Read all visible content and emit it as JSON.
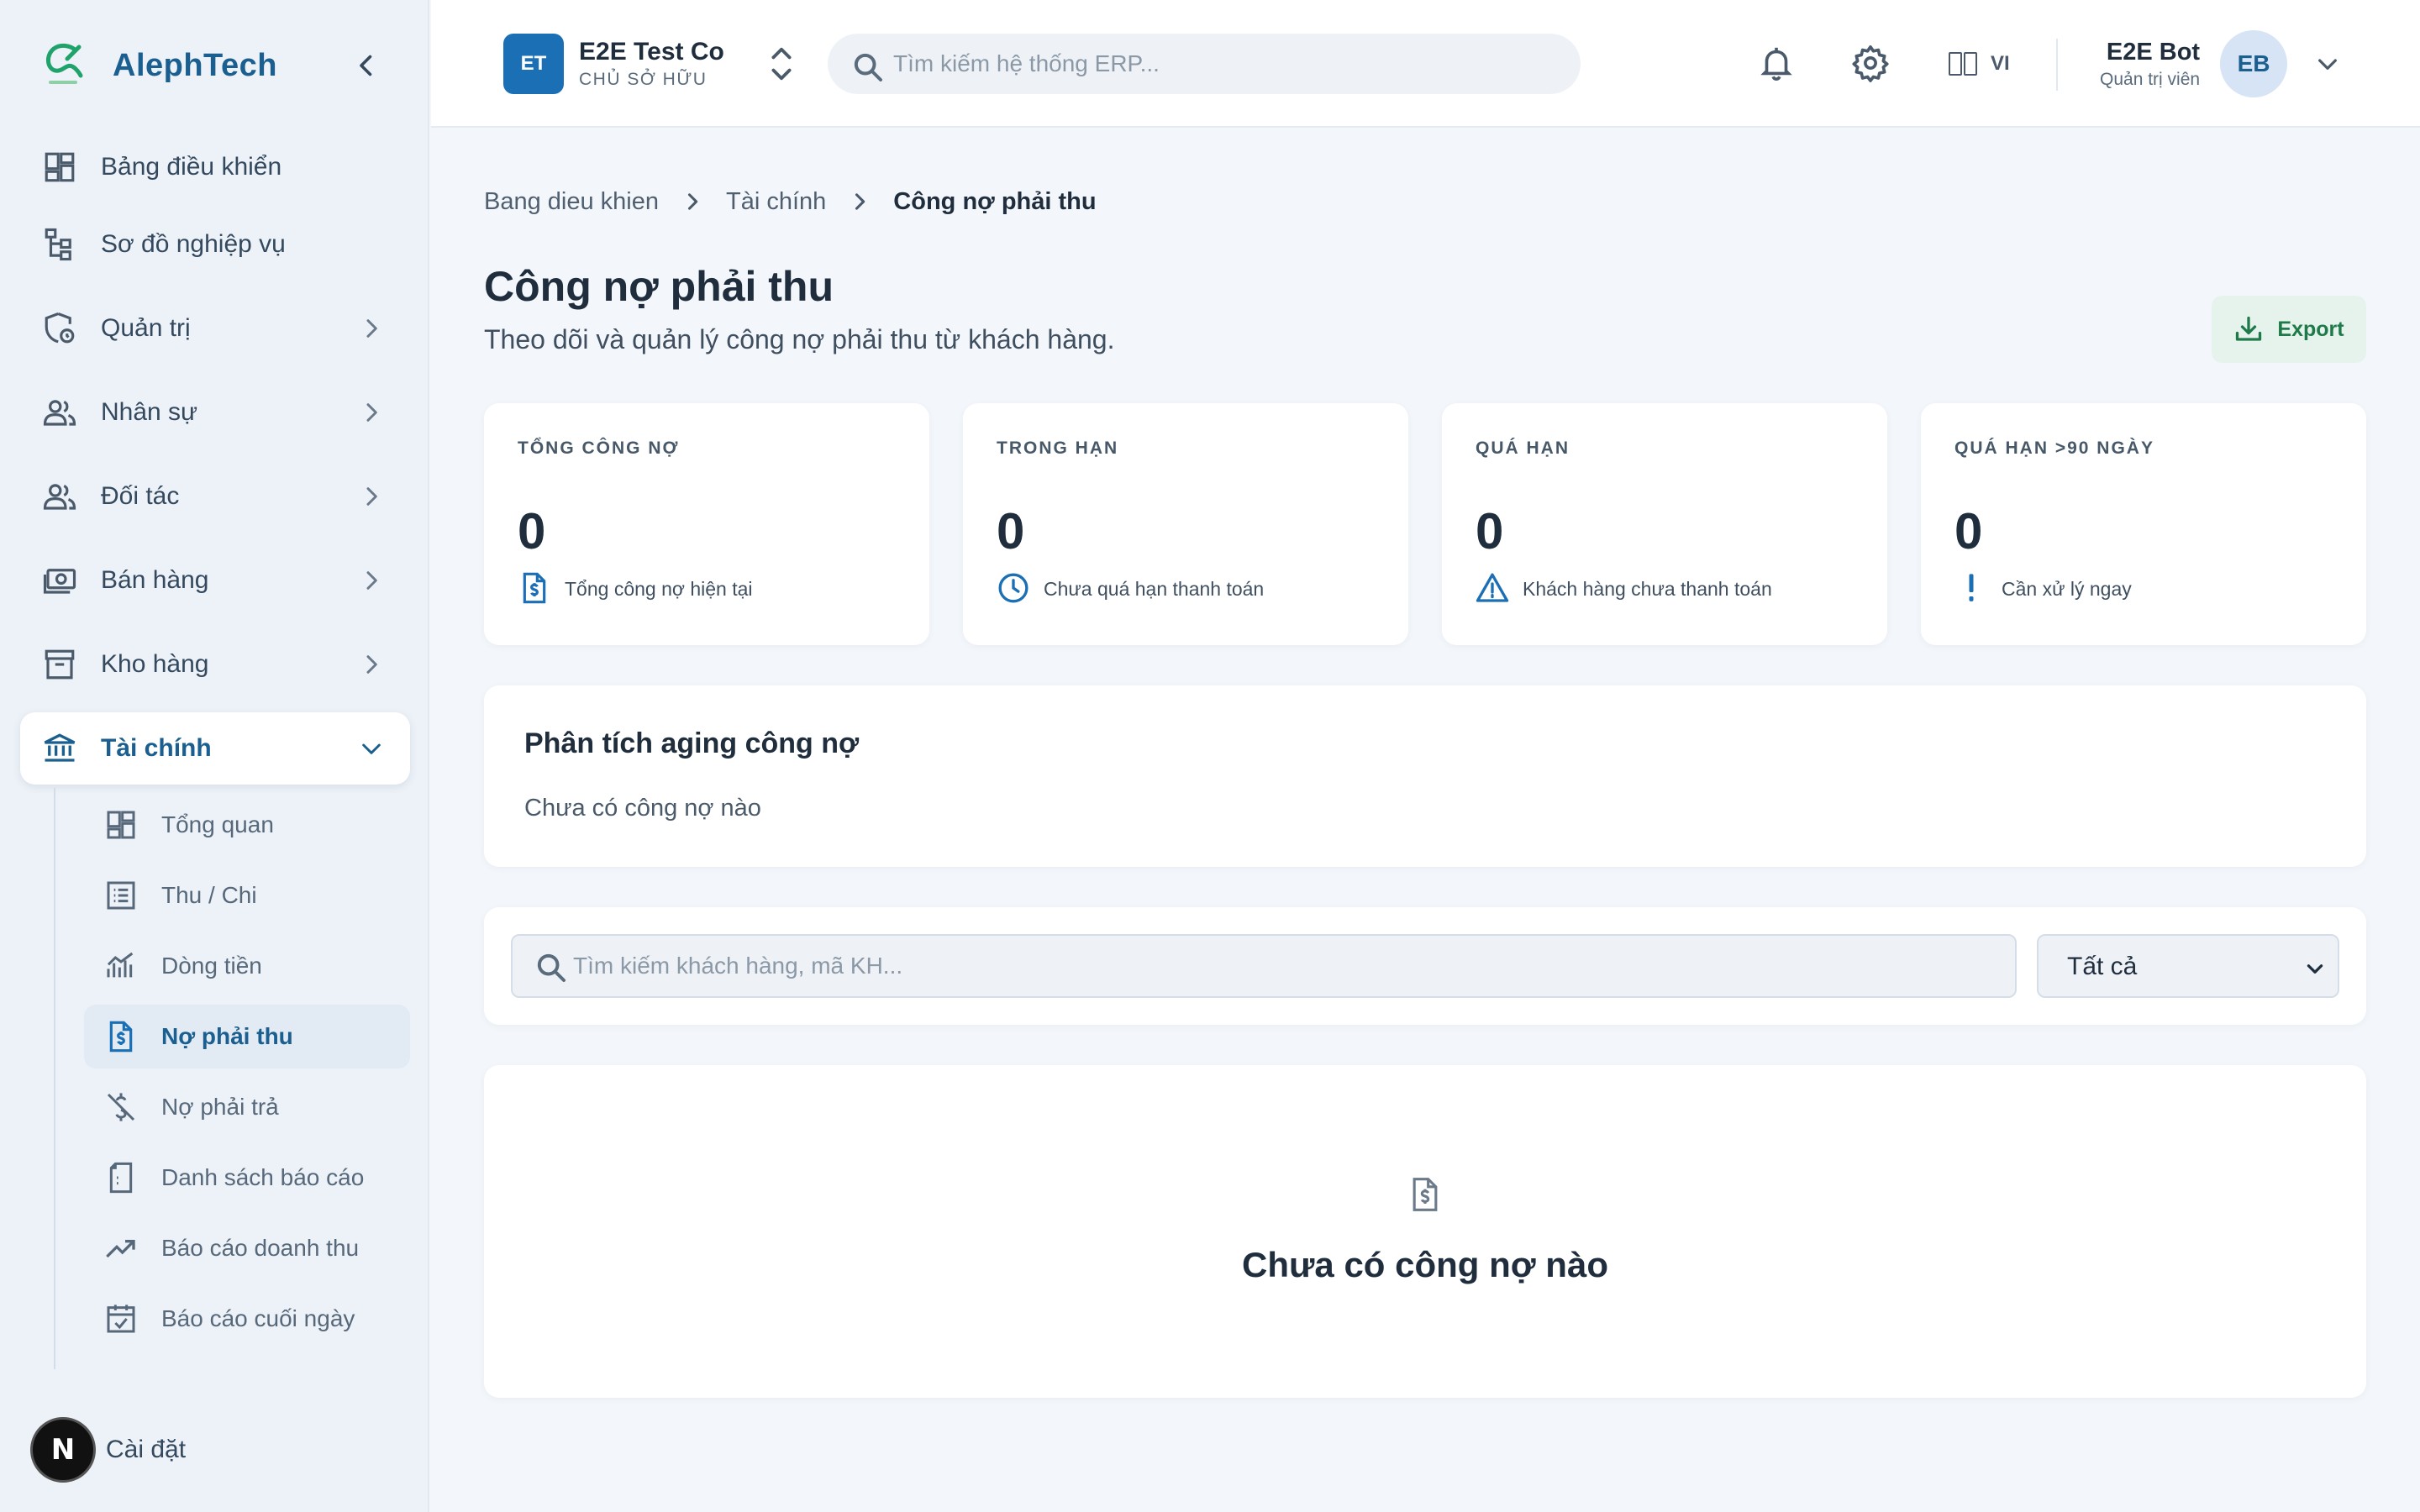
{
  "sidebar": {
    "brand": "AlephTech",
    "items": [
      {
        "label": "Bảng điều khiển",
        "icon": "dashboard-icon"
      },
      {
        "label": "Sơ đồ nghiệp vụ",
        "icon": "sitemap-icon"
      },
      {
        "label": "Quản trị",
        "icon": "admin-shield-icon"
      },
      {
        "label": "Nhân sự",
        "icon": "people-icon"
      },
      {
        "label": "Đối tác",
        "icon": "partners-icon"
      },
      {
        "label": "Bán hàng",
        "icon": "money-icon"
      },
      {
        "label": "Kho hàng",
        "icon": "archive-icon"
      },
      {
        "label": "Tài chính",
        "icon": "bank-icon",
        "expanded": true
      }
    ],
    "sub_items": [
      {
        "label": "Tổng quan",
        "icon": "dashboard-icon"
      },
      {
        "label": "Thu / Chi",
        "icon": "list-icon"
      },
      {
        "label": "Dòng tiền",
        "icon": "chart-icon"
      },
      {
        "label": "Nợ phải thu",
        "icon": "invoice-dollar-icon",
        "active": true
      },
      {
        "label": "Nợ phải trả",
        "icon": "money-off-icon"
      },
      {
        "label": "Danh sách báo cáo",
        "icon": "report-icon"
      },
      {
        "label": "Báo cáo doanh thu",
        "icon": "trending-up-icon"
      },
      {
        "label": "Báo cáo cuối ngày",
        "icon": "calendar-check-icon"
      }
    ],
    "settings_label": "Cài đặt",
    "badge_letter": "N"
  },
  "header": {
    "company": {
      "initials": "ET",
      "name": "E2E Test Co",
      "role": "CHỦ SỞ HỮU"
    },
    "search_placeholder": "Tìm kiếm hệ thống ERP...",
    "language": "VI",
    "user": {
      "name": "E2E Bot",
      "role": "Quản trị viên",
      "initials": "EB"
    }
  },
  "breadcrumb": [
    "Bang dieu khien",
    "Tài chính",
    "Công nợ phải thu"
  ],
  "page": {
    "title": "Công nợ phải thu",
    "subtitle": "Theo dõi và quản lý công nợ phải thu từ khách hàng.",
    "export_label": "Export"
  },
  "stats": [
    {
      "title": "TỔNG CÔNG NỢ",
      "value": "0",
      "desc": "Tổng công nợ hiện tại",
      "icon": "invoice-dollar-icon",
      "color": "#1a6fb5"
    },
    {
      "title": "TRONG HẠN",
      "value": "0",
      "desc": "Chưa quá hạn thanh toán",
      "icon": "clock-icon",
      "color": "#1a6fb5"
    },
    {
      "title": "QUÁ HẠN",
      "value": "0",
      "desc": "Khách hàng chưa thanh toán",
      "icon": "warning-icon",
      "color": "#1a6fb5"
    },
    {
      "title": "QUÁ HẠN >90 NGÀY",
      "value": "0",
      "desc": "Cần xử lý ngay",
      "icon": "exclamation-icon",
      "color": "#1a6fb5"
    }
  ],
  "aging": {
    "title": "Phân tích aging công nợ",
    "empty": "Chưa có công nợ nào"
  },
  "filter": {
    "search_placeholder": "Tìm kiếm khách hàng, mã KH...",
    "status_value": "Tất cả"
  },
  "empty_state": {
    "text": "Chưa có công nợ nào",
    "icon": "invoice-dollar-icon"
  },
  "colors": {
    "accent": "#1a5f8f",
    "primary": "#1a6fb5",
    "success": "#1f7a4a"
  }
}
